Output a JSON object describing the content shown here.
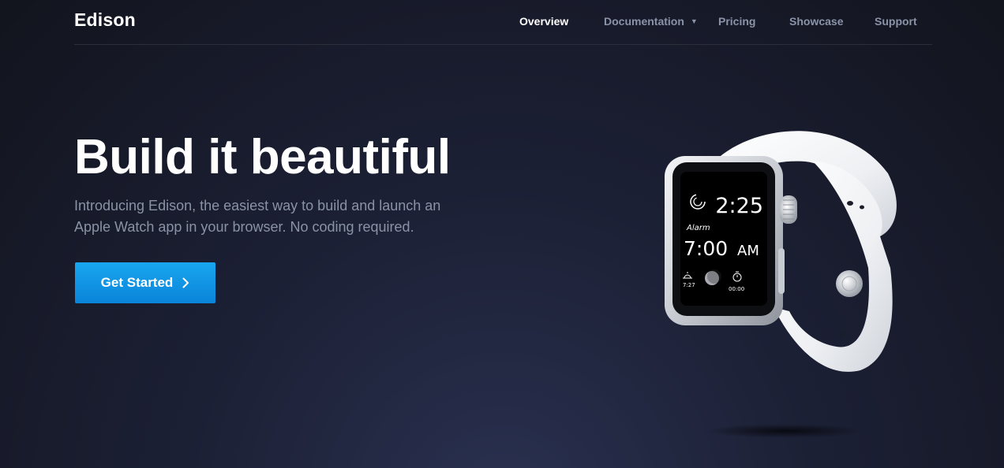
{
  "header": {
    "brand": "Edison",
    "nav": {
      "overview": "Overview",
      "documentation": "Documentation",
      "pricing": "Pricing",
      "showcase": "Showcase",
      "support": "Support"
    },
    "active": "Overview"
  },
  "hero": {
    "title": "Build it beautiful",
    "subtitle": "Introducing Edison, the easiest way to build and launch an Apple Watch app in your browser. No coding required.",
    "cta_label": "Get Started"
  },
  "watch_face": {
    "time": "2:25",
    "alarm_label": "Alarm",
    "alarm_time": "7:00",
    "alarm_ampm": "AM",
    "sunrise": "7:27",
    "stopwatch": "00:00"
  },
  "colors": {
    "accent": "#0f96e6",
    "background": "#161a28",
    "nav_text": "#8b93a8"
  },
  "icons": {
    "nav_caret": "caret-down-icon",
    "cta_arrow": "chevron-right-icon"
  }
}
